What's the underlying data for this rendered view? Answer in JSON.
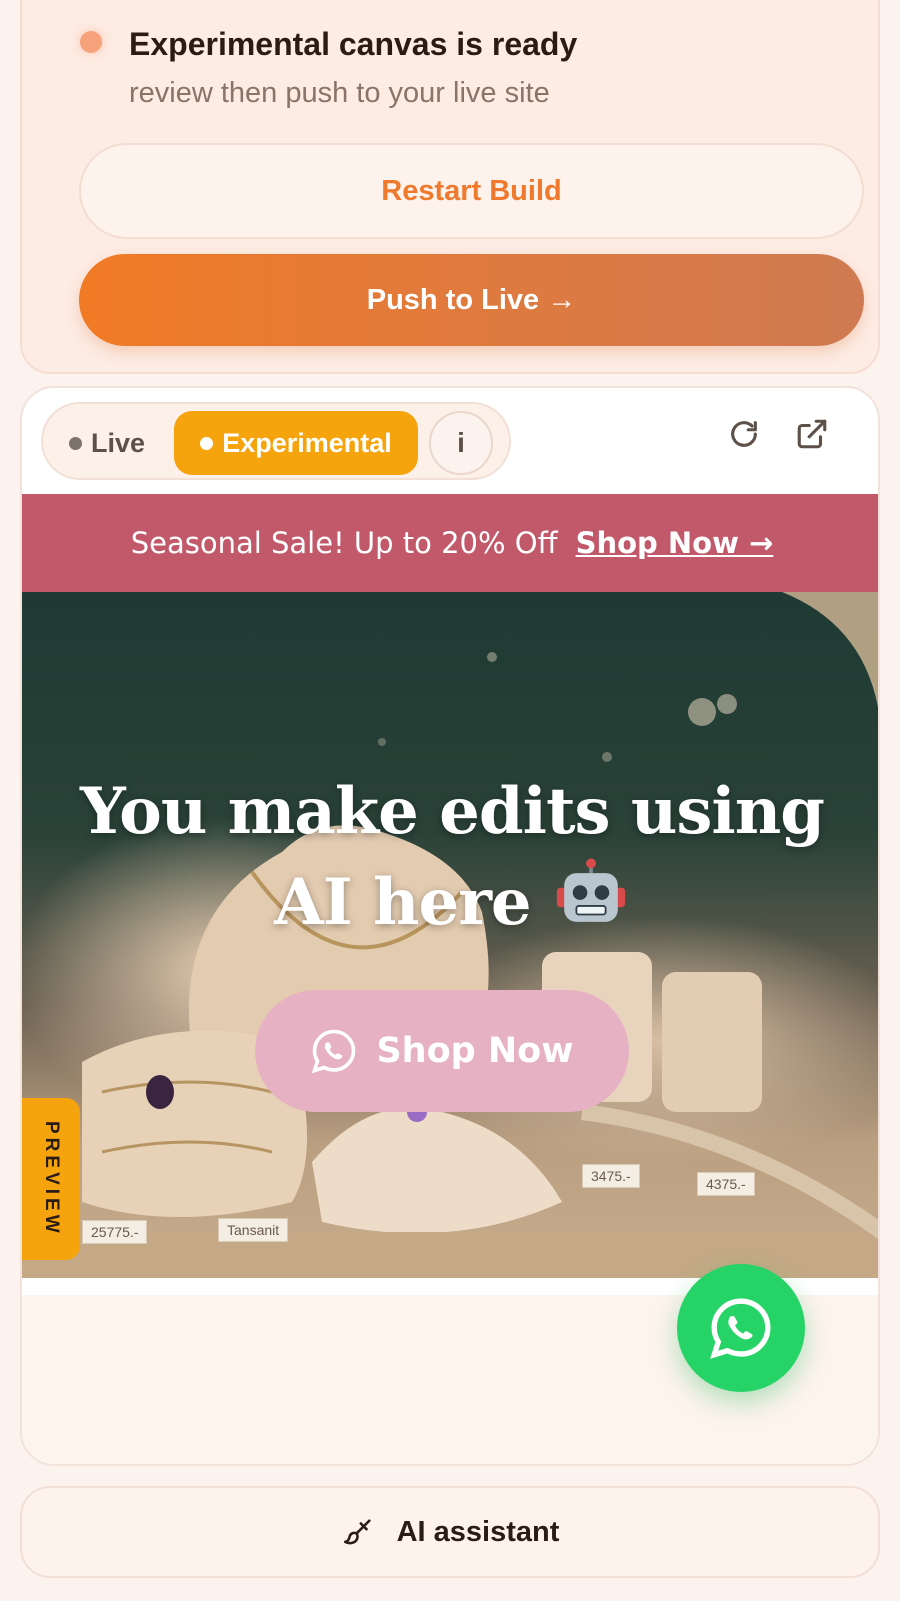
{
  "notice": {
    "title": "Experimental canvas is ready",
    "subtitle": "review then push to your live site",
    "restart_label": "Restart Build",
    "push_label": "Push to Live →"
  },
  "preview": {
    "toggle_live": "Live",
    "toggle_experimental": "Experimental",
    "info_label": "i",
    "active_mode": "Experimental",
    "icons": [
      "refresh-icon",
      "external-link-icon"
    ],
    "banner": {
      "text": "Seasonal Sale! Up to 20% Off",
      "link": "Shop Now →"
    },
    "hero": {
      "title_line1": "You make edits using",
      "title_line2": "AI here",
      "title_emoji": "robot-icon",
      "cta_label": "Shop Now",
      "tags": [
        "25775.-",
        "Tansanit",
        "3475.-",
        "4375.-"
      ]
    },
    "side_tab": "PREVIEW"
  },
  "assistant": {
    "label": "AI assistant"
  },
  "colors": {
    "accent_orange": "#f17a24",
    "toggle_active": "#f5a40d",
    "banner": "#c2596b",
    "cta_pink": "#e6b2c3",
    "whatsapp": "#25d366"
  }
}
